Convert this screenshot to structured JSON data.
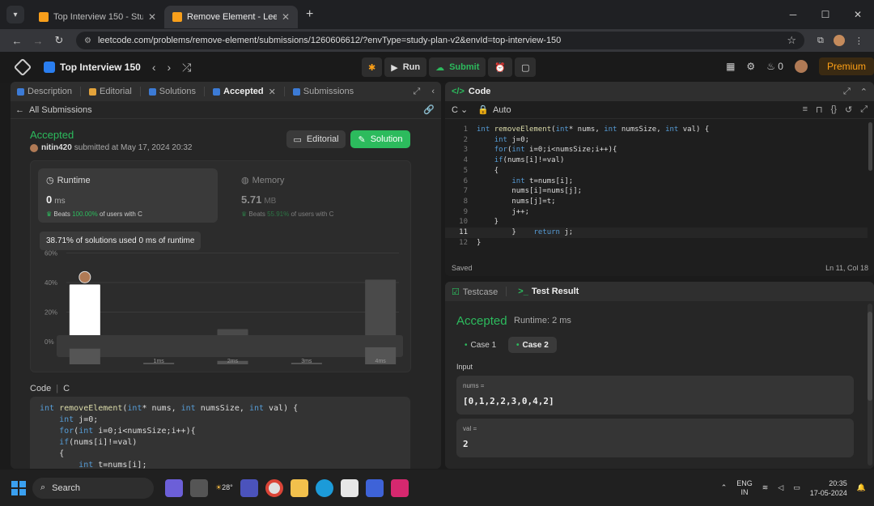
{
  "browser": {
    "tabs": [
      {
        "title": "Top Interview 150 - Study Plan"
      },
      {
        "title": "Remove Element - LeetCode"
      }
    ],
    "url": "leetcode.com/problems/remove-element/submissions/1260606612/?envType=study-plan-v2&envId=top-interview-150"
  },
  "header": {
    "plan_title": "Top Interview 150",
    "run_label": "Run",
    "submit_label": "Submit",
    "streak": "0",
    "premium_label": "Premium"
  },
  "left_tabs": [
    {
      "label": "Description"
    },
    {
      "label": "Editorial"
    },
    {
      "label": "Solutions"
    },
    {
      "label": "Accepted"
    },
    {
      "label": "Submissions"
    }
  ],
  "submission": {
    "back_label": "All Submissions",
    "status": "Accepted",
    "user": "nitin420",
    "submitted": "submitted at May 17, 2024 20:32",
    "editorial_btn": "Editorial",
    "solution_btn": "Solution",
    "runtime": {
      "label": "Runtime",
      "value": "0",
      "unit": "ms",
      "beats_prefix": "Beats",
      "beats_pct": "100.00%",
      "beats_suffix": "of users with C"
    },
    "memory": {
      "label": "Memory",
      "value": "5.71",
      "unit": "MB",
      "beats_prefix": "Beats",
      "beats_pct": "55.91%",
      "beats_suffix": "of users with C"
    },
    "tooltip": "38.71% of solutions used 0 ms of runtime",
    "code_label": "Code",
    "code_lang": "C",
    "code_lines": [
      "int removeElement(int* nums, int numsSize, int val) {",
      "    int j=0;",
      "    for(int i=0;i<numsSize;i++){",
      "    if(nums[i]!=val)",
      "    {",
      "        int t=nums[i];"
    ]
  },
  "chart_data": {
    "type": "bar",
    "categories": [
      "0ms",
      "",
      "1ms",
      "",
      "2ms",
      "",
      "3ms",
      "",
      "4ms"
    ],
    "values": [
      38.71,
      0,
      1,
      0,
      8.5,
      0,
      1,
      0,
      42
    ],
    "highlight_index": 0,
    "y_ticks": [
      "0%",
      "20%",
      "40%",
      "60%"
    ],
    "x_tick_labels": [
      "1ms",
      "2ms",
      "3ms",
      "4ms"
    ],
    "ylim": [
      0,
      60
    ]
  },
  "editor": {
    "title": "Code",
    "language": "C",
    "mode": "Auto",
    "lines": [
      "int removeElement(int* nums, int numsSize, int val) {",
      "    int j=0;",
      "    for(int i=0;i<numsSize;i++){",
      "    if(nums[i]!=val)",
      "    {",
      "        int t=nums[i];",
      "        nums[i]=nums[j];",
      "        nums[j]=t;",
      "        j++;",
      "    }",
      "        }    return j;",
      "}"
    ],
    "saved_label": "Saved",
    "cursor": "Ln 11, Col 18"
  },
  "test": {
    "tab_testcase": "Testcase",
    "tab_result": "Test Result",
    "status": "Accepted",
    "runtime": "Runtime: 2 ms",
    "cases": [
      "Case 1",
      "Case 2"
    ],
    "input_label": "Input",
    "inputs": [
      {
        "name": "nums =",
        "value": "[0,1,2,2,3,0,4,2]"
      },
      {
        "name": "val =",
        "value": "2"
      }
    ]
  },
  "taskbar": {
    "search_label": "Search",
    "weather": "28°",
    "lang_top": "ENG",
    "lang_bottom": "IN",
    "time": "20:35",
    "date": "17-05-2024"
  },
  "colors": {
    "accent_green": "#2cbb5d",
    "leetcode_orange": "#ffa116",
    "bar_default": "#4a4a4a",
    "bar_highlight": "#ffffff"
  }
}
